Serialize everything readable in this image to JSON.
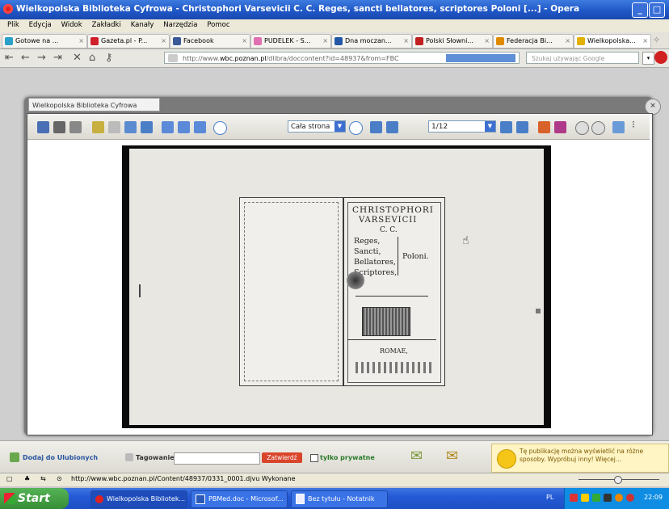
{
  "window": {
    "title": "Wielkopolska Biblioteka Cyfrowa - Christophori Varsevicii C. C. Reges, sancti bellatores, scriptores Poloni [...] - Opera"
  },
  "menu": [
    "Plik",
    "Edycja",
    "Widok",
    "Zakładki",
    "Kanały",
    "Narzędzia",
    "Pomoc"
  ],
  "tabs": [
    {
      "label": "Gotowe na ...",
      "color": "#2aa0c8"
    },
    {
      "label": "Gazeta.pl - P...",
      "color": "#d0202a"
    },
    {
      "label": "Facebook",
      "color": "#3b5998"
    },
    {
      "label": "PUDELEK - S...",
      "color": "#e070b0"
    },
    {
      "label": "Dna moczan...",
      "color": "#2457a6"
    },
    {
      "label": "Polski Słowni...",
      "color": "#c02020"
    },
    {
      "label": "Federacja Bi...",
      "color": "#e08a00"
    },
    {
      "label": "Wielkopolska...",
      "color": "#e2b000"
    }
  ],
  "address": {
    "prefix": "http://www.",
    "domain": "wbc.poznan.pl",
    "rest": "/dlibra/doccontent?id=48937&from=FBC",
    "search_placeholder": "Szukaj używając Google"
  },
  "dialog": {
    "tab_label": "Wielkopolska Biblioteka Cyfrowa",
    "zoom_value": "Cała strona",
    "page_value": "1/12"
  },
  "book": {
    "line1": "CHRISTOPHORI",
    "line2": "VARSEVICII",
    "line3": "C. C.",
    "line4": "Reges,",
    "line5": "Sancti,",
    "line6": "Bellatores,",
    "line7": "Scriptores,",
    "side": "Poloni.",
    "line8": "ROMAE,"
  },
  "bottom": {
    "favorites": "Dodaj do Ulubionych",
    "tagging": "Tagowanie",
    "approve": "Zatwierdź",
    "private_only": "tylko prywatne",
    "tip": "Tę publikację można wyświetlić na różne sposoby. Wypróbuj inny! Więcej..."
  },
  "status": {
    "url": "http://www.wbc.poznan.pl/Content/48937/0331_0001.djvu Wykonane"
  },
  "taskbar": {
    "start": "Start",
    "tasks": [
      "Wielkopolska Bibliotek...",
      "PBMed.doc - Microsof...",
      "Bez tytułu - Notatnik"
    ],
    "lang": "PL",
    "time": "22:09"
  }
}
